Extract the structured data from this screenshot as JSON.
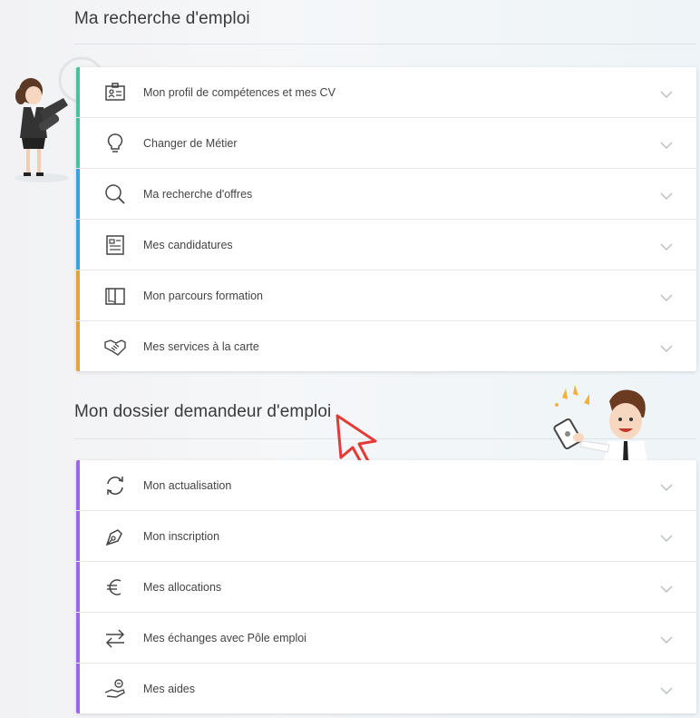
{
  "section1": {
    "title": "Ma recherche d'emploi",
    "items": [
      {
        "label": "Mon profil de compétences et mes CV",
        "icon": "id-card-icon",
        "color": "#4bbf9f"
      },
      {
        "label": "Changer de Métier",
        "icon": "lightbulb-icon",
        "color": "#4bbf9f"
      },
      {
        "label": "Ma recherche d'offres",
        "icon": "search-icon",
        "color": "#3ba3db"
      },
      {
        "label": "Mes candidatures",
        "icon": "document-list-icon",
        "color": "#3ba3db"
      },
      {
        "label": "Mon parcours formation",
        "icon": "book-icon",
        "color": "#e0a540"
      },
      {
        "label": "Mes services à la carte",
        "icon": "handshake-icon",
        "color": "#e0a540"
      }
    ]
  },
  "section2": {
    "title": "Mon dossier demandeur d'emploi",
    "items": [
      {
        "label": "Mon actualisation",
        "icon": "refresh-icon",
        "color": "#a067e6"
      },
      {
        "label": "Mon inscription",
        "icon": "pen-nib-icon",
        "color": "#a067e6"
      },
      {
        "label": "Mes allocations",
        "icon": "euro-icon",
        "color": "#a067e6"
      },
      {
        "label": "Mes échanges avec Pôle emploi",
        "icon": "exchange-arrows-icon",
        "color": "#a067e6"
      },
      {
        "label": "Mes aides",
        "icon": "helping-hand-icon",
        "color": "#a067e6"
      }
    ]
  }
}
